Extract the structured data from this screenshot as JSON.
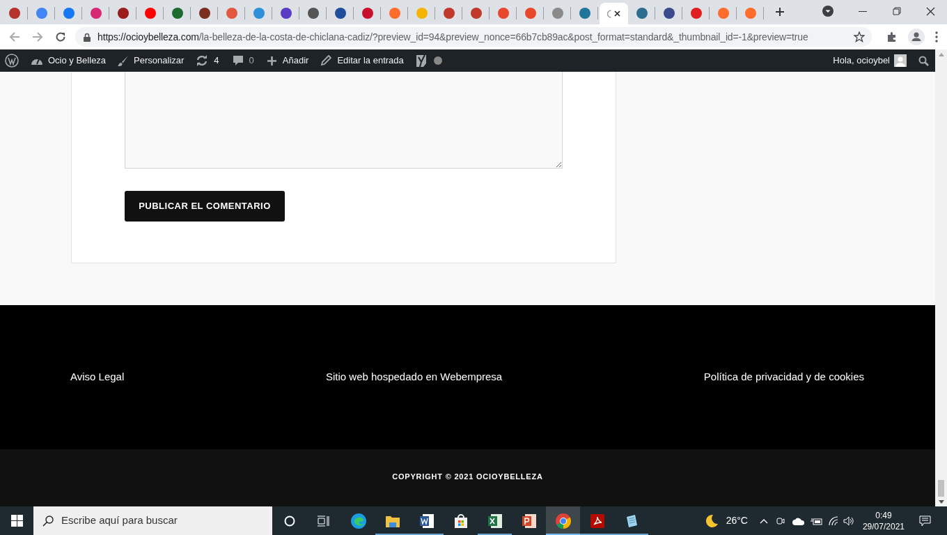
{
  "tabs": [
    {
      "color": "#b5332a",
      "selected": false
    },
    {
      "color": "#4285f4",
      "selected": false
    },
    {
      "color": "#1877f2",
      "selected": false
    },
    {
      "color": "#d62976",
      "selected": false
    },
    {
      "color": "#9b1c1c",
      "selected": false
    },
    {
      "color": "#ff0000",
      "selected": false
    },
    {
      "color": "#1d6b2f",
      "selected": false
    },
    {
      "color": "#7a2e1e",
      "selected": false
    },
    {
      "color": "#e2583e",
      "selected": false
    },
    {
      "color": "#2f8fd8",
      "selected": false
    },
    {
      "color": "#5b3cc4",
      "selected": false
    },
    {
      "color": "#555555",
      "selected": false
    },
    {
      "color": "#1f4e9c",
      "selected": false
    },
    {
      "color": "#c8102e",
      "selected": false
    },
    {
      "color": "#ff6c2c",
      "selected": false
    },
    {
      "color": "#f4b400",
      "selected": false
    },
    {
      "color": "#c0392b",
      "selected": false
    },
    {
      "color": "#c0392b",
      "selected": false
    },
    {
      "color": "#e8472b",
      "selected": false
    },
    {
      "color": "#e8472b",
      "selected": false
    },
    {
      "color": "#8a8a8a",
      "selected": false
    },
    {
      "color": "#21759b",
      "selected": false
    },
    {
      "color": "#9e9e9e",
      "selected": true
    },
    {
      "color": "#2c6e8f",
      "selected": false
    },
    {
      "color": "#3a4a8c",
      "selected": false
    },
    {
      "color": "#e02020",
      "selected": false
    },
    {
      "color": "#ff6c2c",
      "selected": false
    },
    {
      "color": "#ff6c2c",
      "selected": false
    }
  ],
  "address_bar": {
    "url_host": "https://ocioybelleza.com",
    "url_path": "/la-belleza-de-la-costa-de-chiclana-cadiz/?preview_id=94&preview_nonce=66b7cb89ac&post_format=standard&_thumbnail_id=-1&preview=true"
  },
  "admin_bar": {
    "site": "Ocio y Belleza",
    "customize": "Personalizar",
    "updates": "4",
    "comments": "0",
    "new": "Añadir",
    "edit": "Editar la entrada",
    "greeting": "Hola, ocioybel"
  },
  "comment_form": {
    "submit": "PUBLICAR EL COMENTARIO"
  },
  "footer": {
    "links": [
      "Aviso Legal",
      "Sitio web hospedado en Webempresa",
      "Política de privacidad y de cookies"
    ],
    "copyright": "COPYRIGHT © 2021 OCIOYBELLEZA"
  },
  "taskbar": {
    "search_placeholder": "Escribe aquí para buscar",
    "apps": [
      {
        "kind": "edge",
        "running": false,
        "selected": false
      },
      {
        "kind": "folder",
        "running": true,
        "selected": false
      },
      {
        "kind": "word",
        "running": true,
        "selected": false
      },
      {
        "kind": "store",
        "running": false,
        "selected": false
      },
      {
        "kind": "excel",
        "running": true,
        "selected": false
      },
      {
        "kind": "powerpoint",
        "running": false,
        "selected": false
      },
      {
        "kind": "chrome",
        "running": true,
        "selected": true
      },
      {
        "kind": "acrobat",
        "running": true,
        "selected": false
      },
      {
        "kind": "notepad",
        "running": true,
        "selected": false
      }
    ],
    "temperature": "26°C",
    "time": "0:49",
    "date": "29/07/2021"
  }
}
